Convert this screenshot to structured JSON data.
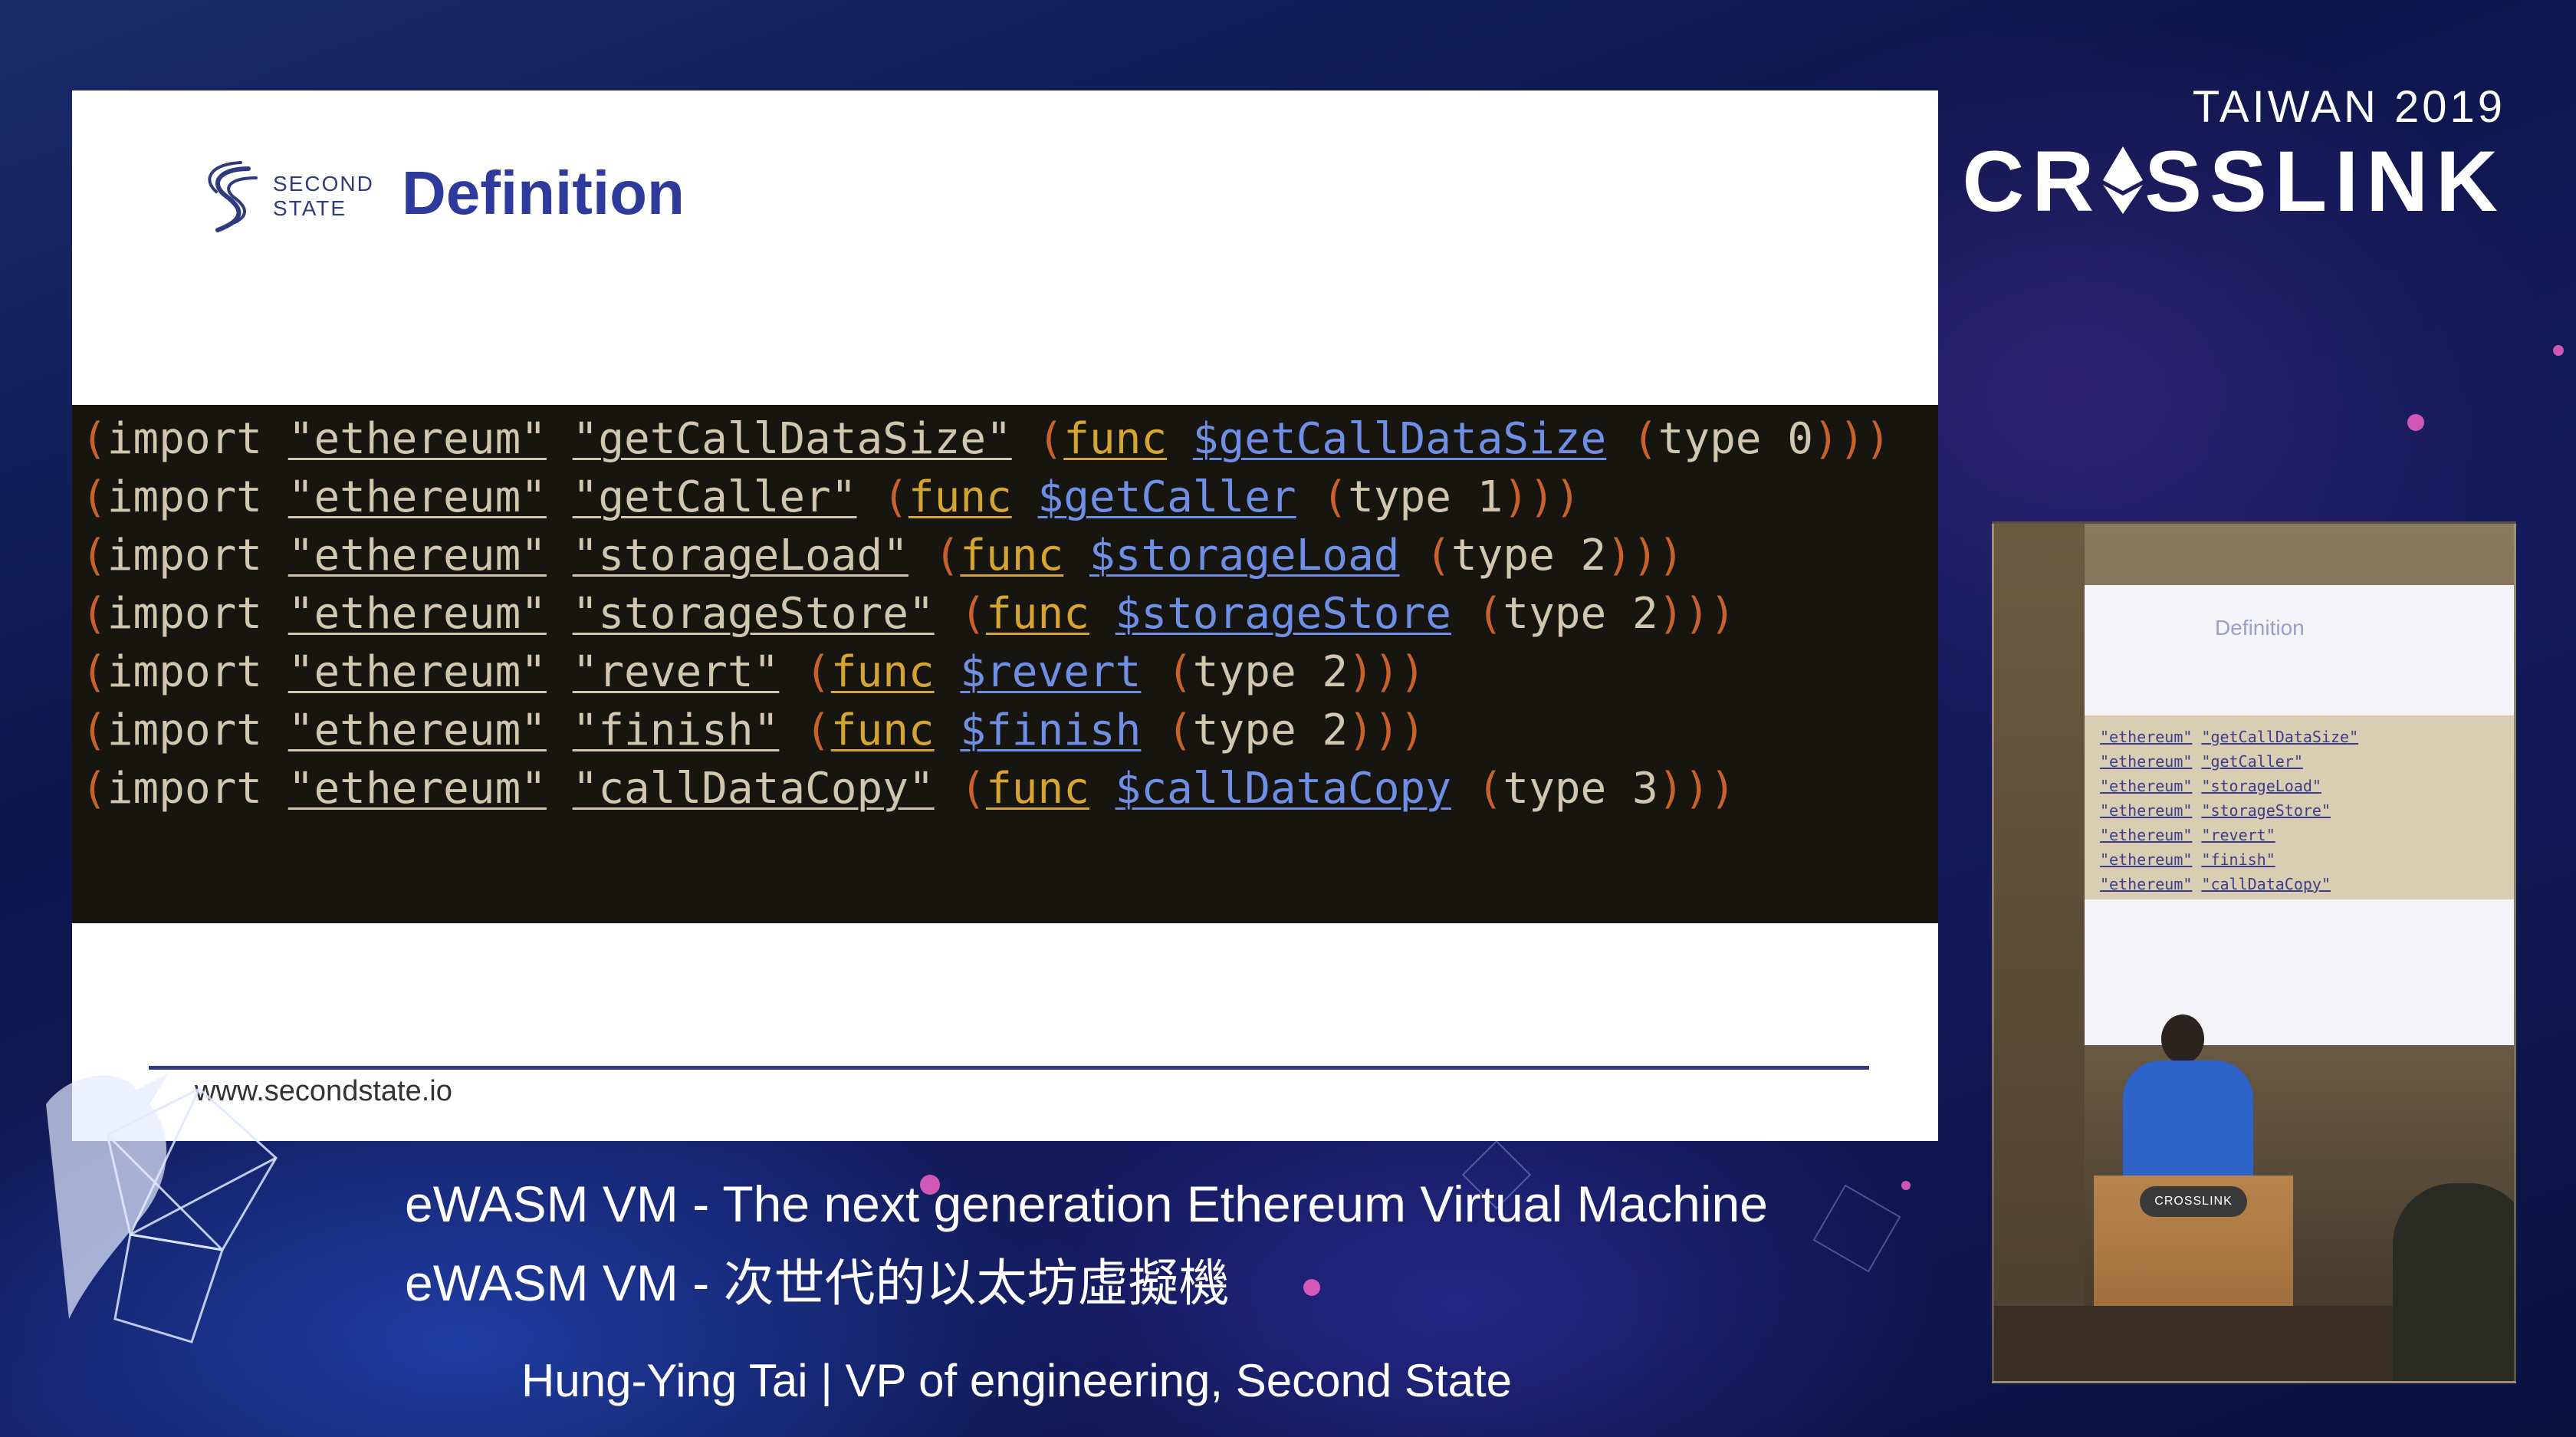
{
  "slide": {
    "logo_text_line1": "SECOND",
    "logo_text_line2": "STATE",
    "title": "Definition",
    "url": "www.secondstate.io",
    "code_lines": [
      {
        "module": "\"ethereum\"",
        "field": "\"getCallDataSize\"",
        "func_kw": "func",
        "func_name": "$getCallDataSize",
        "type_kw": "type",
        "type_index": "0"
      },
      {
        "module": "\"ethereum\"",
        "field": "\"getCaller\"",
        "func_kw": "func",
        "func_name": "$getCaller",
        "type_kw": "type",
        "type_index": "1"
      },
      {
        "module": "\"ethereum\"",
        "field": "\"storageLoad\"",
        "func_kw": "func",
        "func_name": "$storageLoad",
        "type_kw": "type",
        "type_index": "2"
      },
      {
        "module": "\"ethereum\"",
        "field": "\"storageStore\"",
        "func_kw": "func",
        "func_name": "$storageStore",
        "type_kw": "type",
        "type_index": "2"
      },
      {
        "module": "\"ethereum\"",
        "field": "\"revert\"",
        "func_kw": "func",
        "func_name": "$revert",
        "type_kw": "type",
        "type_index": "2"
      },
      {
        "module": "\"ethereum\"",
        "field": "\"finish\"",
        "func_kw": "func",
        "func_name": "$finish",
        "type_kw": "type",
        "type_index": "2"
      },
      {
        "module": "\"ethereum\"",
        "field": "\"callDataCopy\"",
        "func_kw": "func",
        "func_name": "$callDataCopy",
        "type_kw": "type",
        "type_index": "3"
      }
    ],
    "import_kw": "import"
  },
  "event": {
    "year_label": "TAIWAN 2019",
    "name_part1": "CR",
    "name_part2": "SSLINK"
  },
  "camera": {
    "screen_title": "Definition",
    "podium_badge": "CROSSLINK",
    "code_fields": [
      "\"getCallDataSize\"",
      "\"getCaller\"",
      "\"storageLoad\"",
      "\"storageStore\"",
      "\"revert\"",
      "\"finish\"",
      "\"callDataCopy\""
    ]
  },
  "lower_third": {
    "title_en": "eWASM VM - The next generation Ethereum Virtual Machine",
    "title_zh": "eWASM VM - 次世代的以太坊虛擬機",
    "speaker": "Hung-Ying Tai | VP of engineering, Second State"
  },
  "colors": {
    "slide_title": "#2f3b9c",
    "code_bg": "#17150f",
    "paren": "#c9612a",
    "func_keyword": "#d6a52f",
    "func_name": "#6f8fe6",
    "accent_pink": "#ff66cc"
  }
}
